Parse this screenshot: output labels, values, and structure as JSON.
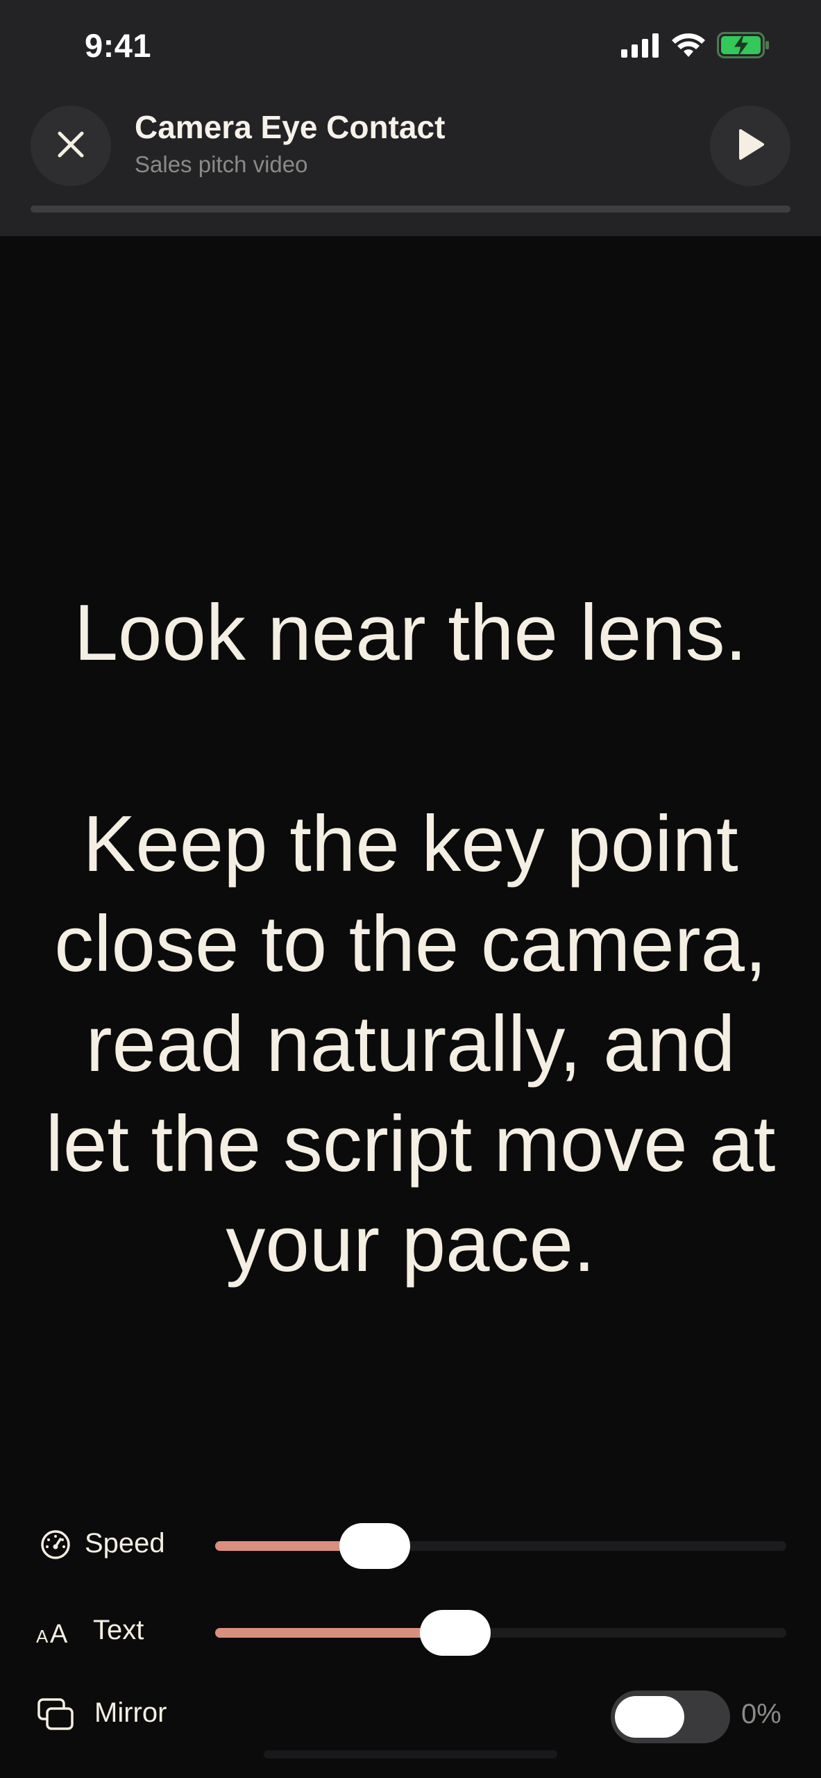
{
  "status_bar": {
    "time": "9:41",
    "icons": [
      "cellular-signal-icon",
      "wifi-icon",
      "battery-charging-icon"
    ],
    "battery_color": "#34c759"
  },
  "header": {
    "title": "Camera Eye Contact",
    "subtitle": "Sales pitch video",
    "close_icon": "close-icon",
    "play_icon": "play-icon",
    "progress": 0
  },
  "script": {
    "paragraph_1": "Look near the lens.",
    "paragraph_2": "Keep the key point close to the camera, read naturally, and let the script move at your pace."
  },
  "controls": {
    "speed": {
      "label": "Speed",
      "icon": "speedometer-icon",
      "value": 0.28
    },
    "text": {
      "label": "Text",
      "icon": "text-size-icon",
      "icon_glyph": "AA",
      "value": 0.42
    },
    "mirror": {
      "label": "Mirror",
      "icon": "mirror-icon",
      "value_text": "0%",
      "on": false
    }
  },
  "colors": {
    "accent": "#d98f7e",
    "background": "#0b0b0c",
    "header_background": "#232325",
    "script_text": "#f4efe2"
  }
}
